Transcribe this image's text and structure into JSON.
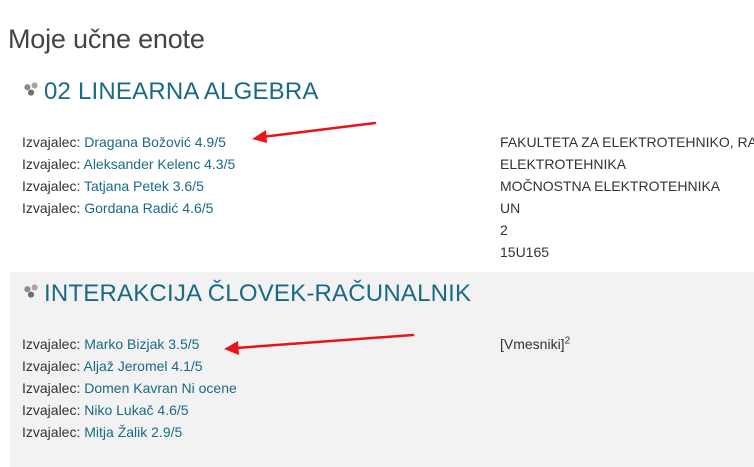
{
  "page": {
    "title": "Moje učne enote"
  },
  "courses": [
    {
      "name": "02 LINEARNA ALGEBRA",
      "teacher_prefix": "Izvajalec:",
      "teachers": [
        {
          "name": "Dragana Božović 4.9/5"
        },
        {
          "name": "Aleksander Kelenc 4.3/5"
        },
        {
          "name": "Tatjana Petek 3.6/5"
        },
        {
          "name": "Gordana Radić 4.6/5"
        }
      ],
      "info": [
        "FAKULTETA ZA ELEKTROTEHNIKO, RAČ",
        "ELEKTROTEHNIKA",
        "MOČNOSTNA ELEKTROTEHNIKA",
        "UN",
        "2",
        "15U165"
      ]
    },
    {
      "name": "INTERAKCIJA ČLOVEK-RAČUNALNIK",
      "teacher_prefix": "Izvajalec:",
      "teachers": [
        {
          "name": "Marko Bizjak 3.5/5"
        },
        {
          "name": "Aljaž Jeromel 4.1/5"
        },
        {
          "name": "Domen Kavran Ni ocene"
        },
        {
          "name": "Niko Lukač 4.6/5"
        },
        {
          "name": "Mitja Žalik 2.9/5"
        }
      ],
      "info_main": "[Vmesniki]",
      "info_sup": "2"
    }
  ],
  "icons": {
    "course": "course-nodes-icon",
    "annotation": "red-arrow-icon"
  },
  "colors": {
    "link": "#1a6a85",
    "text": "#333333",
    "title": "#444444",
    "alt_row": "#f2f2f2",
    "annotation_arrow": "#e8141a"
  }
}
